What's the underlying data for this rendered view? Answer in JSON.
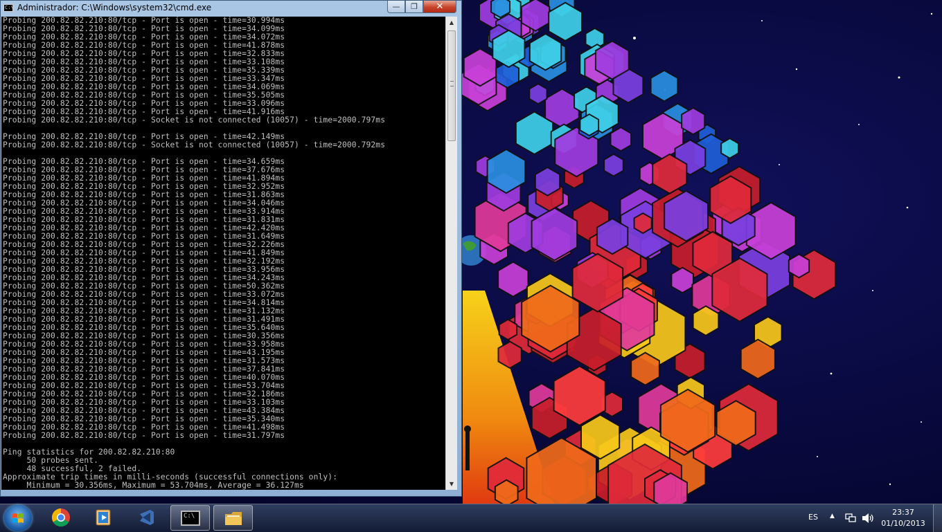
{
  "window": {
    "title": "Administrador: C:\\Windows\\system32\\cmd.exe",
    "icon_label": "C:\\",
    "minimize": "—",
    "maximize": "❐",
    "close": "✕",
    "scroll_up": "▲",
    "scroll_down": "▼"
  },
  "console": {
    "lines": [
      "Probing 200.82.82.210:80/tcp - Port is open - time=30.994ms",
      "Probing 200.82.82.210:80/tcp - Port is open - time=34.099ms",
      "Probing 200.82.82.210:80/tcp - Port is open - time=34.072ms",
      "Probing 200.82.82.210:80/tcp - Port is open - time=41.878ms",
      "Probing 200.82.82.210:80/tcp - Port is open - time=32.833ms",
      "Probing 200.82.82.210:80/tcp - Port is open - time=33.108ms",
      "Probing 200.82.82.210:80/tcp - Port is open - time=35.339ms",
      "Probing 200.82.82.210:80/tcp - Port is open - time=33.347ms",
      "Probing 200.82.82.210:80/tcp - Port is open - time=34.069ms",
      "Probing 200.82.82.210:80/tcp - Port is open - time=35.505ms",
      "Probing 200.82.82.210:80/tcp - Port is open - time=33.096ms",
      "Probing 200.82.82.210:80/tcp - Port is open - time=41.916ms",
      "Probing 200.82.82.210:80/tcp - Socket is not connected (10057) - time=2000.797ms",
      "",
      "Probing 200.82.82.210:80/tcp - Port is open - time=42.149ms",
      "Probing 200.82.82.210:80/tcp - Socket is not connected (10057) - time=2000.792ms",
      "",
      "Probing 200.82.82.210:80/tcp - Port is open - time=34.659ms",
      "Probing 200.82.82.210:80/tcp - Port is open - time=37.676ms",
      "Probing 200.82.82.210:80/tcp - Port is open - time=41.894ms",
      "Probing 200.82.82.210:80/tcp - Port is open - time=32.952ms",
      "Probing 200.82.82.210:80/tcp - Port is open - time=31.863ms",
      "Probing 200.82.82.210:80/tcp - Port is open - time=34.046ms",
      "Probing 200.82.82.210:80/tcp - Port is open - time=33.914ms",
      "Probing 200.82.82.210:80/tcp - Port is open - time=31.831ms",
      "Probing 200.82.82.210:80/tcp - Port is open - time=42.420ms",
      "Probing 200.82.82.210:80/tcp - Port is open - time=31.649ms",
      "Probing 200.82.82.210:80/tcp - Port is open - time=32.226ms",
      "Probing 200.82.82.210:80/tcp - Port is open - time=41.849ms",
      "Probing 200.82.82.210:80/tcp - Port is open - time=32.192ms",
      "Probing 200.82.82.210:80/tcp - Port is open - time=33.956ms",
      "Probing 200.82.82.210:80/tcp - Port is open - time=34.243ms",
      "Probing 200.82.82.210:80/tcp - Port is open - time=50.362ms",
      "Probing 200.82.82.210:80/tcp - Port is open - time=33.072ms",
      "Probing 200.82.82.210:80/tcp - Port is open - time=34.814ms",
      "Probing 200.82.82.210:80/tcp - Port is open - time=31.132ms",
      "Probing 200.82.82.210:80/tcp - Port is open - time=31.491ms",
      "Probing 200.82.82.210:80/tcp - Port is open - time=35.640ms",
      "Probing 200.82.82.210:80/tcp - Port is open - time=30.356ms",
      "Probing 200.82.82.210:80/tcp - Port is open - time=33.958ms",
      "Probing 200.82.82.210:80/tcp - Port is open - time=43.195ms",
      "Probing 200.82.82.210:80/tcp - Port is open - time=31.573ms",
      "Probing 200.82.82.210:80/tcp - Port is open - time=37.841ms",
      "Probing 200.82.82.210:80/tcp - Port is open - time=40.070ms",
      "Probing 200.82.82.210:80/tcp - Port is open - time=53.704ms",
      "Probing 200.82.82.210:80/tcp - Port is open - time=32.186ms",
      "Probing 200.82.82.210:80/tcp - Port is open - time=33.103ms",
      "Probing 200.82.82.210:80/tcp - Port is open - time=43.384ms",
      "Probing 200.82.82.210:80/tcp - Port is open - time=35.340ms",
      "Probing 200.82.82.210:80/tcp - Port is open - time=41.498ms",
      "Probing 200.82.82.210:80/tcp - Port is open - time=31.797ms",
      "",
      "Ping statistics for 200.82.82.210:80",
      "     50 probes sent.",
      "     48 successful, 2 failed.",
      "Approximate trip times in milli-seconds (successful connections only):",
      "     Minimum = 30.356ms, Maximum = 53.704ms, Average = 36.127ms"
    ]
  },
  "taskbar": {
    "apps": [
      {
        "name": "chrome",
        "open": false
      },
      {
        "name": "media-player",
        "open": false
      },
      {
        "name": "visual-studio",
        "open": false
      },
      {
        "name": "command-prompt",
        "open": true
      },
      {
        "name": "windows-explorer",
        "open": true
      }
    ],
    "cmd_icon_label": "C:\\",
    "language": "ES",
    "tray_arrow": "▲",
    "time": "23:37",
    "date": "01/10/2013"
  },
  "colors": {
    "console_bg": "#000000",
    "console_fg": "#c0c0c0",
    "close_red": "#c7442b"
  }
}
